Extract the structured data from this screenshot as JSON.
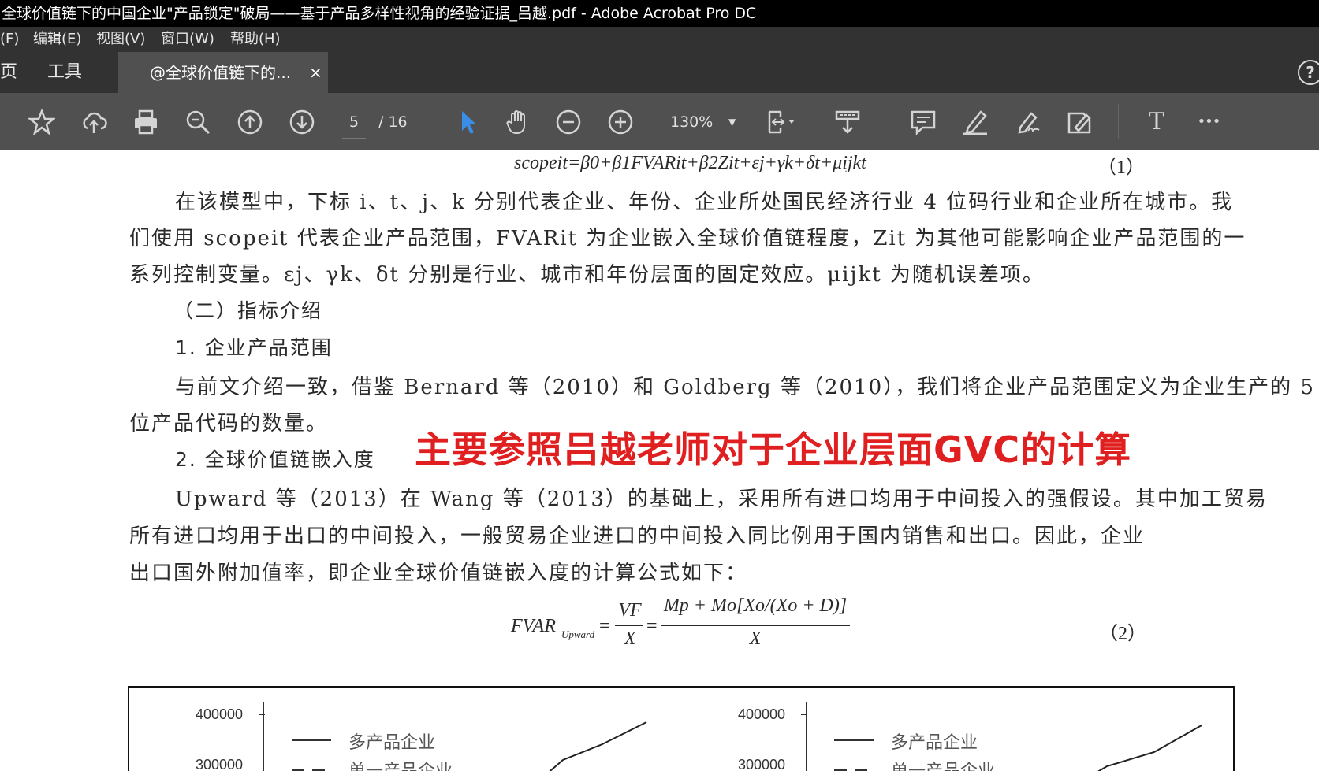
{
  "window": {
    "title": "全球价值链下的中国企业\"产品锁定\"破局——基于产品多样性视角的经验证据_吕越.pdf - Adobe Acrobat Pro DC"
  },
  "menu": [
    "(F)",
    "编辑(E)",
    "视图(V)",
    "窗口(W)",
    "帮助(H)"
  ],
  "tabs": {
    "home": "页",
    "tools": "工具",
    "doc": "@全球价值链下的...",
    "close": "×",
    "help": "?"
  },
  "toolbar": {
    "page_current": "5",
    "page_total": "/ 16",
    "zoom": "130%",
    "text_tool": "T",
    "more": "•••"
  },
  "icons": [
    "star-icon",
    "cloud-upload-icon",
    "print-icon",
    "zoom-search-icon",
    "page-up-icon",
    "page-down-icon",
    "select-cursor-icon",
    "hand-icon",
    "zoom-out-icon",
    "zoom-in-icon",
    "scroll-mode-icon",
    "stamp-icon",
    "comment-icon",
    "highlight-pen-icon",
    "sign-icon",
    "edit-icon",
    "text-icon",
    "more-icon"
  ],
  "document": {
    "eq1": "scopeit=β0+β1FVARit+β2Zit+εj+γk+δt+μijkt",
    "eq1_num": "（1）",
    "para1_l1": "在该模型中，下标 i、t、j、k 分别代表企业、年份、企业所处国民经济行业 4 位码行业和企业所在城市。我",
    "para1_l2": "们使用 scopeit 代表企业产品范围，FVARit 为企业嵌入全球价值链程度，Zit 为其他可能影响企业产品范围的一",
    "para1_l3": "系列控制变量。εj、γk、δt 分别是行业、城市和年份层面的固定效应。μijkt 为随机误差项。",
    "heading2": "（二）指标介绍",
    "heading2_1": "1. 企业产品范围",
    "para2_l1": "与前文介绍一致，借鉴 Bernard 等（2010）和 Goldberg 等（2010），我们将企业产品范围定义为企业生产的 5",
    "para2_l2": "位产品代码的数量。",
    "heading2_2": "2. 全球价值链嵌入度",
    "annotation": "主要参照吕越老师对于企业层面GVC的计算",
    "para3_l1": "Upward 等（2013）在 Wang 等（2013）的基础上，采用所有进口均用于中间投入的强假设。其中加工贸易",
    "para3_l2": "所有进口均用于出口的中间投入，一般贸易企业进口的中间投入同比例用于国内销售和出口。因此，企业",
    "para3_l3": "出口国外附加值率，即企业全球价值链嵌入度的计算公式如下：",
    "eq2_lhs": "FVAR",
    "eq2_sub": "Upward",
    "eq2_frac1_num": "VF",
    "eq2_frac1_den": "X",
    "eq2_frac2_num": "Mp + Mo[Xo/(Xo + D)]",
    "eq2_frac2_den": "X",
    "eq2_num": "（2）"
  },
  "figure": {
    "left": {
      "tick_top": "400000",
      "tick_second": "300000",
      "legend1": "多产品企业",
      "legend2": "单一产品企业"
    },
    "right": {
      "tick_top": "400000",
      "tick_second": "300000",
      "legend1": "多产品企业",
      "legend2": "单一产品企业"
    }
  }
}
